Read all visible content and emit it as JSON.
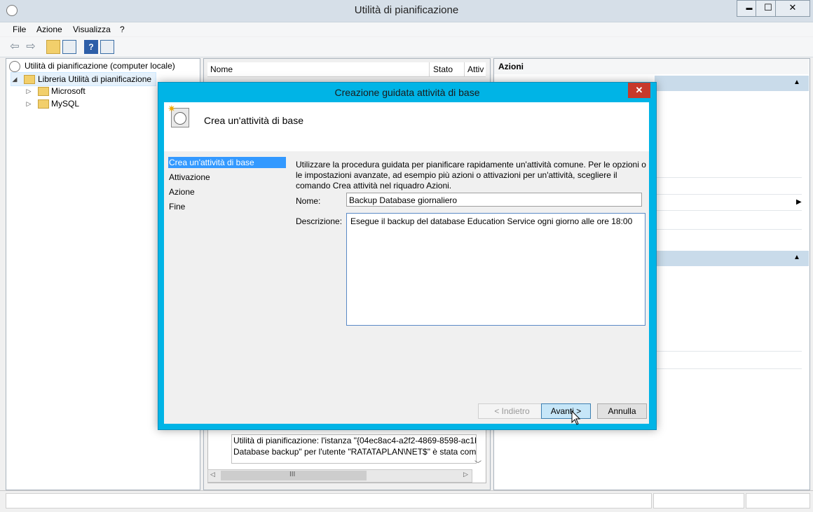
{
  "window": {
    "title": "Utilità di pianificazione",
    "minimize": "▬",
    "maximize": "☐",
    "close": "✕"
  },
  "menu": [
    "File",
    "Azione",
    "Visualizza",
    "?"
  ],
  "tree": {
    "root": "Utilità di pianificazione (computer locale)",
    "library": "Libreria Utilità di pianificazione",
    "children": [
      "Microsoft",
      "MySQL"
    ]
  },
  "task_list": {
    "columns": [
      "Nome",
      "Stato",
      "Attiv"
    ]
  },
  "detail": {
    "line1": "Utilità di pianificazione: l'istanza \"{04ec8ac4-a2f2-4869-8598-ac1b",
    "line2": "Database backup\" per l'utente \"RATATAPLAN\\NET$\" è stata com",
    "scroll_grip": "III"
  },
  "actions": {
    "header": "Azioni"
  },
  "dialog": {
    "title": "Creazione guidata attività di base",
    "close": "✕",
    "heading": "Crea un'attività di base",
    "steps": [
      "Crea un'attività di base",
      "Attivazione",
      "Azione",
      "Fine"
    ],
    "intro": "Utilizzare la procedura guidata per pianificare rapidamente un'attività comune. Per le opzioni o le impostazioni avanzate, ad esempio più azioni o attivazioni per un'attività, scegliere il comando Crea attività nel riquadro Azioni.",
    "name_label": "Nome:",
    "name_value": "Backup Database giornaliero",
    "desc_label": "Descrizione:",
    "desc_value": "Esegue il backup del database Education Service ogni giorno alle ore 18:00",
    "btn_back": "< Indietro",
    "btn_next": "Avanti >",
    "btn_cancel": "Annulla"
  },
  "colors": {
    "dialog_frame": "#00b4e6",
    "selection": "#3399ff",
    "close_red": "#c7392b"
  }
}
